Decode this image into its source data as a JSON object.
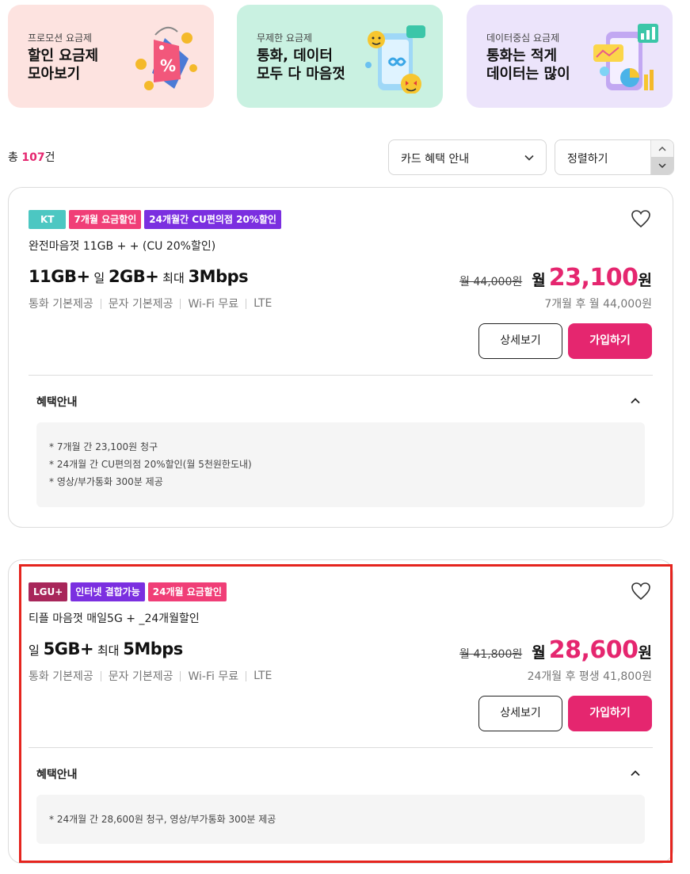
{
  "banners": [
    {
      "subtitle": "프로모션 요금제",
      "title": "할인 요금제\n모아보기",
      "icon": "price-tag-icon",
      "color": "#fde3e0"
    },
    {
      "subtitle": "무제한 요금제",
      "title": "통화, 데이터\n모두 다 마음껏",
      "icon": "phone-emoji-icon",
      "color": "#c9f1e1"
    },
    {
      "subtitle": "데이터중심 요금제",
      "title": "통화는 적게\n데이터는 많이",
      "icon": "data-chart-icon",
      "color": "#ece4fb"
    }
  ],
  "toolbar": {
    "total_prefix": "총 ",
    "total_count": "107",
    "total_suffix": "건",
    "card_select": "카드 혜택 안내",
    "sort_select": "정렬하기"
  },
  "plans": [
    {
      "badges": [
        {
          "label": "KT",
          "color": "#4cc7c2"
        },
        {
          "label": "7개월 요금할인",
          "color": "#f03e77"
        },
        {
          "label": "24개월간 CU편의점 20%할인",
          "color": "#7b2fe0"
        }
      ],
      "name": "완전마음껏 11GB + + (CU 20%할인)",
      "spec": {
        "main": "11GB+",
        "daily_prefix": "일",
        "daily": "2GB+",
        "max_prefix": "최대",
        "max": "3Mbps"
      },
      "features": [
        "통화 기본제공",
        "문자 기본제공",
        "Wi-Fi 무료",
        "LTE"
      ],
      "original_price": "월 44,000원",
      "price_prefix": "월",
      "price": "23,100",
      "price_unit": "원",
      "after_price": "7개월 후 월 44,000원",
      "detail_label": "상세보기",
      "join_label": "가입하기",
      "benefit_title": "혜택안내",
      "benefits": [
        "* 7개월 간 23,100원 청구",
        "* 24개월 간 CU편의점 20%할인(월 5천원한도내)",
        "* 영상/부가통화 300분 제공"
      ]
    },
    {
      "badges": [
        {
          "label": "LGU+",
          "color": "#a8265a"
        },
        {
          "label": "인터넷 결합가능",
          "color": "#7b2fe0"
        },
        {
          "label": "24개월 요금할인",
          "color": "#f03e77"
        }
      ],
      "name": "티플 마음껏 매일5G + _24개월할인",
      "spec": {
        "main": "",
        "daily_prefix": "일",
        "daily": "5GB+",
        "max_prefix": "최대",
        "max": "5Mbps"
      },
      "features": [
        "통화 기본제공",
        "문자 기본제공",
        "Wi-Fi 무료",
        "LTE"
      ],
      "original_price": "월 41,800원",
      "price_prefix": "월",
      "price": "28,600",
      "price_unit": "원",
      "after_price": "24개월 후 평생 41,800원",
      "detail_label": "상세보기",
      "join_label": "가입하기",
      "benefit_title": "혜택안내",
      "benefits": [
        "* 24개월 간 28,600원 청구, 영상/부가통화 300분 제공"
      ]
    }
  ],
  "colors": {
    "accent": "#e5266f",
    "highlight": "#e5241e"
  }
}
